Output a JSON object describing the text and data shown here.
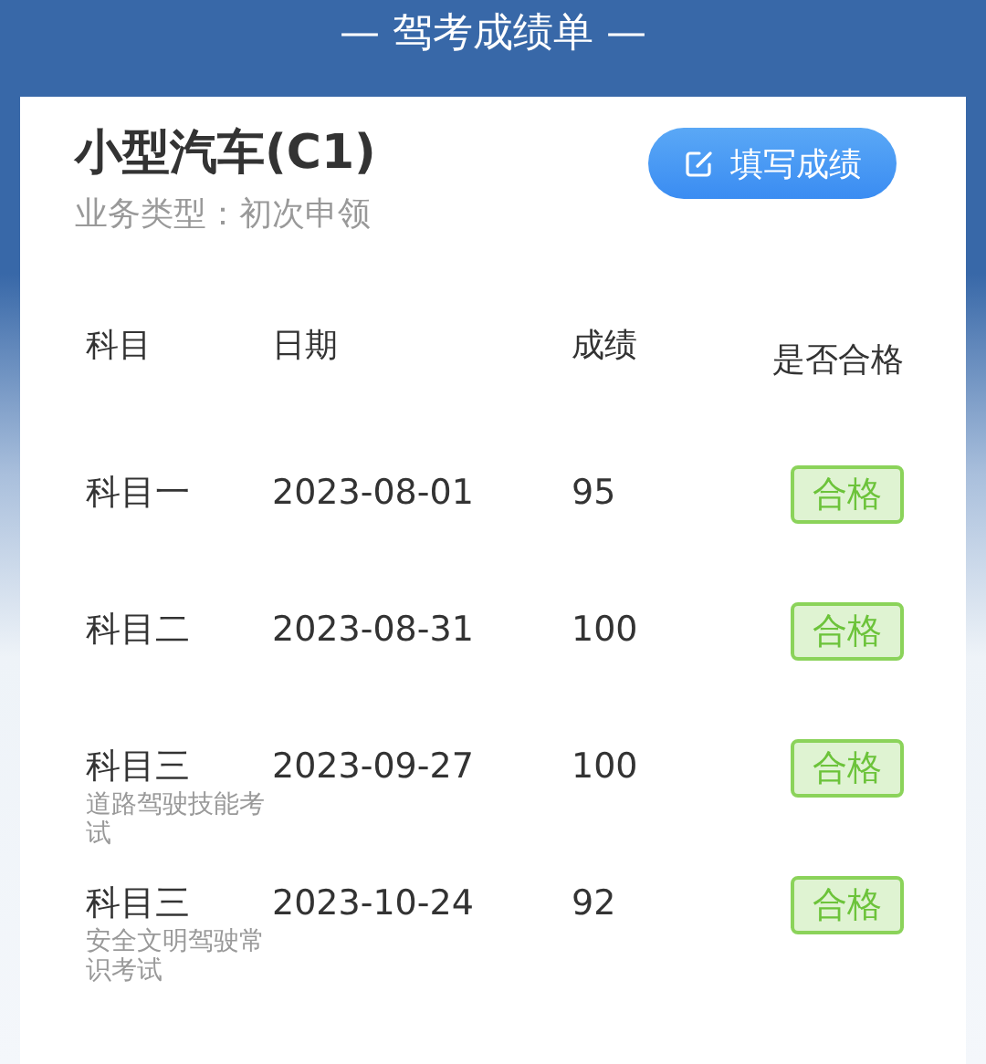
{
  "header": {
    "title": "— 驾考成绩单 —"
  },
  "card": {
    "title": "小型汽车(C1)",
    "subtitle": "业务类型：初次申领",
    "button": "填写成绩"
  },
  "table": {
    "columns": [
      "科目",
      "日期",
      "成绩",
      "是否合格"
    ],
    "rows": [
      {
        "subject": "科目一",
        "date": "2023-08-01",
        "score": "95",
        "result": "合格",
        "passed": true
      },
      {
        "subject": "科目二",
        "date": "2023-08-31",
        "score": "100",
        "result": "合格",
        "passed": true
      },
      {
        "subject": "科目三",
        "note": "道路驾驶技能考试",
        "date": "2023-09-27",
        "score": "100",
        "result": "合格",
        "passed": true
      },
      {
        "subject": "科目三",
        "note": "安全文明驾驶常识考试",
        "date": "2023-10-24",
        "score": "92",
        "result": "合格",
        "passed": true
      }
    ]
  }
}
